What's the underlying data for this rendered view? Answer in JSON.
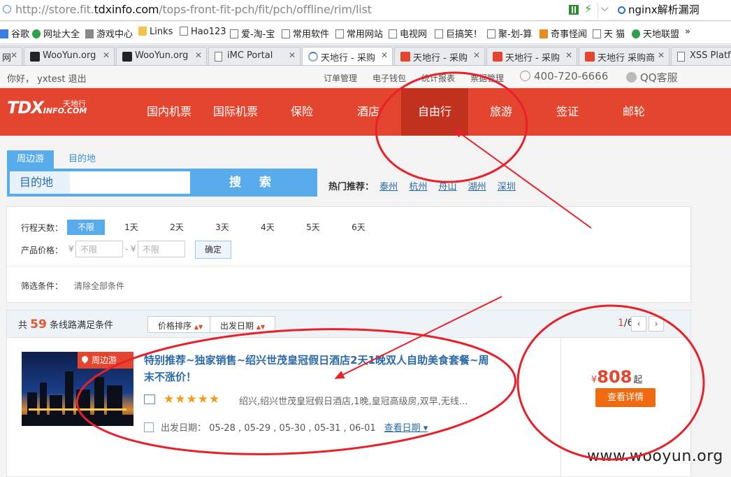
{
  "browser": {
    "url_gray": "http://store.fit.",
    "url_domain": "tdxinfo.com",
    "url_path": "/tops-front-fit-pch/fit/pch/offline/rim/list",
    "search_text": "nginx解析漏洞",
    "bookmarks": [
      "谷歌",
      "网址大全",
      "游戏中心",
      "Links",
      "Hao123",
      "爱-淘-宝",
      "常用软件",
      "常用网站",
      "电视网",
      "巨搞笑！",
      "聚-划-算",
      "奇事怪闻",
      "天 猫",
      "天地联盟",
      "»"
    ],
    "tabs": [
      "网",
      "WooYun.org",
      "WooYun.org",
      "iMC Portal",
      "天地行 - 采购",
      "天地行 - 采购",
      "天地行 - 采购",
      "天地行 采购商",
      "XSS Platf"
    ]
  },
  "topbar": {
    "greeting": "你好， yxtest 退出",
    "links": [
      "订单管理",
      "电子钱包",
      "统计报表",
      "票据管理"
    ],
    "phone": "400-720-6666",
    "qq": "QQ客服"
  },
  "logo": {
    "main": "TDX",
    "sub": "INFO.COM",
    "cn": "天地行"
  },
  "nav": [
    "国内机票",
    "国际机票",
    "保险",
    "酒店",
    "自由行",
    "旅游",
    "签证",
    "邮轮"
  ],
  "search": {
    "tabs": [
      "周边游",
      "目的地"
    ],
    "label": "目的地",
    "button": "搜 索",
    "hot_label": "热门推荐：",
    "hot_cities": [
      "泰州",
      "杭州",
      "舟山",
      "湖州",
      "深圳"
    ]
  },
  "filter": {
    "days_label": "行程天数：",
    "days": [
      "不限",
      "1天",
      "2天",
      "3天",
      "4天",
      "5天",
      "6天"
    ],
    "price_label": "产品价格：",
    "currency": "¥",
    "dash": "-",
    "placeholder": "不限",
    "confirm": "确定",
    "cond_label": "筛选条件：",
    "clear": "清除全部条件"
  },
  "results": {
    "prefix": "共",
    "count": "59",
    "suffix": "条线路满足条件",
    "sort_price": "价格排序",
    "sort_date": "出发日期",
    "page_current": "1",
    "page_total": "/6"
  },
  "product": {
    "tag": "周边游",
    "title": "特别推荐~独家销售~绍兴世茂皇冠假日酒店2天1晚双人自助美食套餐~周末不涨价！",
    "stars": "★★★★★",
    "rating": 4.5,
    "features": "绍兴,绍兴世茂皇冠假日酒店,1晚,皇冠高级房,双早,无线...",
    "depart_label": "出发日期：",
    "dates": "05-28 , 05-29 , 05-30 , 05-31 , 06-01",
    "view_dates": "查看日期",
    "currency": "¥",
    "price": "808",
    "price_suffix": "起",
    "detail_button": "查看详情"
  },
  "watermark": "www.wooyun.org",
  "colors": {
    "brand_red": "#e4452f",
    "nav_active": "#c0321e",
    "accent_blue": "#58aceb",
    "price_orange": "#f06a10"
  }
}
